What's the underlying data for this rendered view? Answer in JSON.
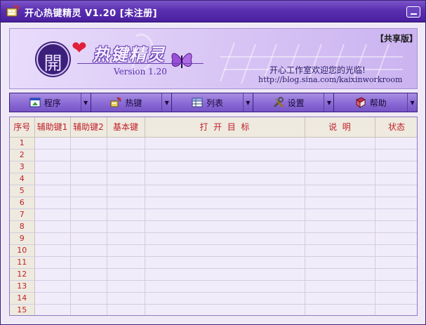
{
  "window": {
    "title": "开心热键精灵  V1.20  [未注册]"
  },
  "banner": {
    "edition": "【共享版】",
    "logo_char": "開",
    "logo_text": "热键精灵",
    "version": "Version 1.20",
    "welcome": "开心工作室欢迎您的光临!",
    "url": "http://blog.sina.com/kaixinworkroom"
  },
  "toolbar": {
    "program": {
      "label": "程序",
      "icon": "program-icon"
    },
    "hotkey": {
      "label": "热键",
      "icon": "hotkey-icon"
    },
    "list": {
      "label": "列表",
      "icon": "list-icon"
    },
    "settings": {
      "label": "设置",
      "icon": "tools-icon"
    },
    "help": {
      "label": "帮助",
      "icon": "help-book-icon"
    }
  },
  "table": {
    "columns": [
      "序号",
      "辅助键1",
      "辅助键2",
      "基本键",
      "打  开  目  标",
      "说  明",
      "状态"
    ],
    "rows": [
      "1",
      "2",
      "3",
      "4",
      "5",
      "6",
      "7",
      "8",
      "9",
      "10",
      "11",
      "12",
      "13",
      "14",
      "15"
    ]
  },
  "colors": {
    "title_bar": "#5a2fb0",
    "header_text": "#c0202a",
    "grid_bg": "#f1ecfa"
  }
}
